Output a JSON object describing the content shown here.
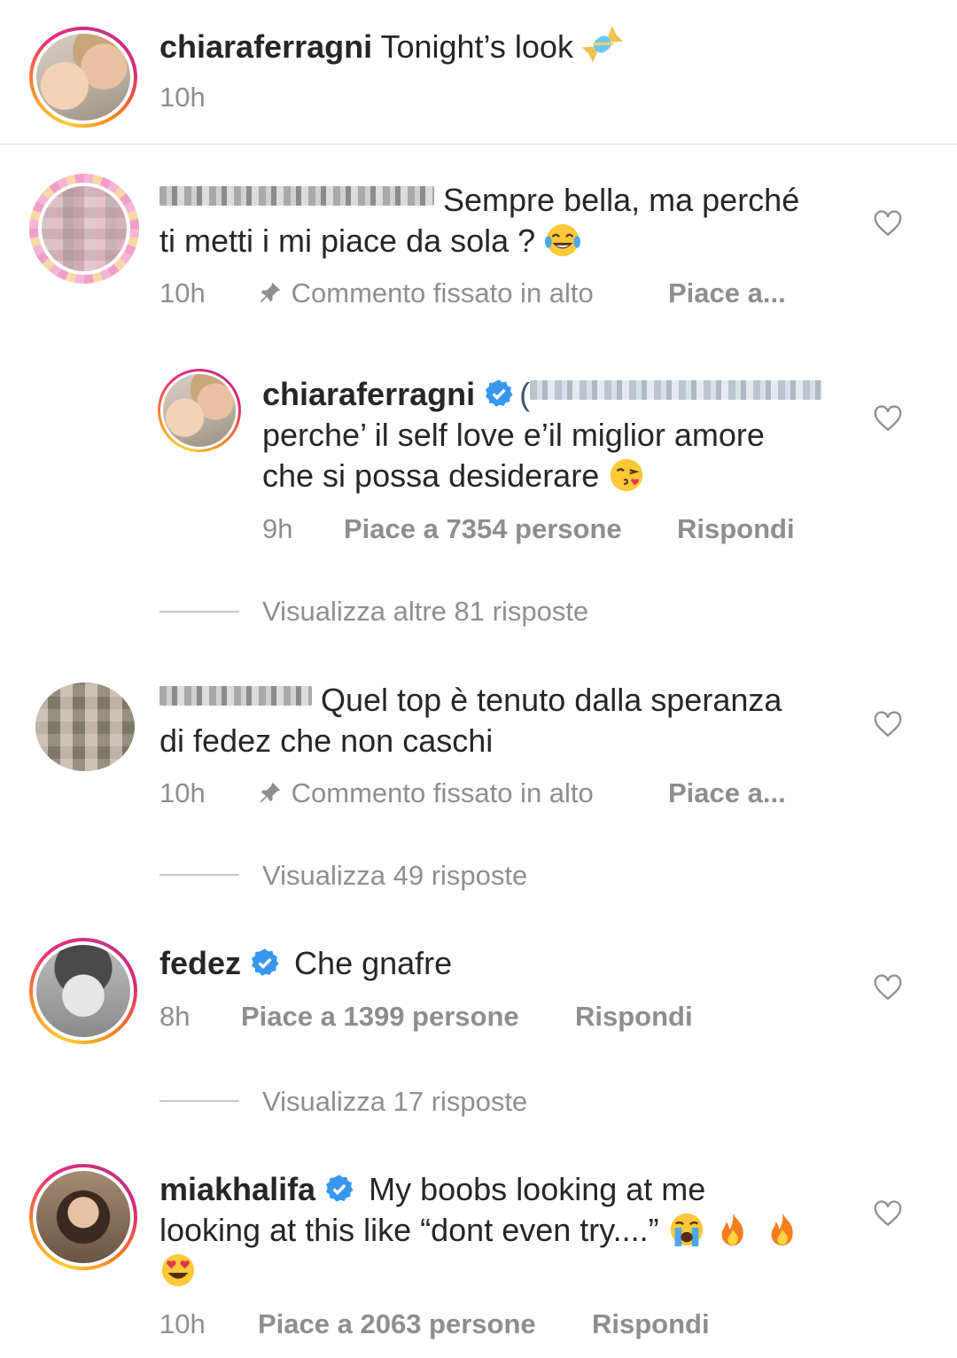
{
  "caption": {
    "username": "chiaraferragni",
    "text": "Tonight’s look",
    "emoji": "candy",
    "time": "10h"
  },
  "comments": [
    {
      "username_redacted": true,
      "text_line1": "Sempre bella, ma perché",
      "text_line2": "ti metti i mi piace da sola ?",
      "emoji": "tears-of-joy",
      "time": "10h",
      "pinned_label": "Commento fissato in alto",
      "likes_label": "Piace a..."
    },
    {
      "username_redacted": true,
      "text_line1": "Quel top è tenuto dalla speranza",
      "text_line2": "di fedez che non caschi",
      "time": "10h",
      "pinned_label": "Commento fissato in alto",
      "likes_label": "Piace a..."
    },
    {
      "username": "fedez",
      "verified": true,
      "text": "Che gnafre",
      "time": "8h",
      "likes_label": "Piace a 1399 persone",
      "reply_label": "Rispondi"
    },
    {
      "username": "miakhalifa",
      "verified": true,
      "text_line1": "My boobs looking at me",
      "text_line2": "looking at this like “dont even try....”",
      "emojis": [
        "loudly-crying",
        "fire",
        "fire",
        "heart-eyes"
      ],
      "time": "10h",
      "likes_label": "Piace a 2063 persone",
      "reply_label": "Rispondi"
    }
  ],
  "reply": {
    "username": "chiaraferragni",
    "verified": true,
    "mention_redacted": true,
    "text_line1": "perche’ il self love e’il miglior amore",
    "text_line2": "che si possa desiderare",
    "emoji": "kissing-heart",
    "time": "9h",
    "likes_label": "Piace a 7354 persone",
    "reply_label": "Rispondi"
  },
  "view_replies": [
    "Visualizza altre 81 risposte",
    "Visualizza 49 risposte",
    "Visualizza 17 risposte"
  ],
  "colors": {
    "text": "#262626",
    "secondary": "#8e8e8e",
    "verified_blue": "#3897f0",
    "divider": "#dbdbdb"
  }
}
